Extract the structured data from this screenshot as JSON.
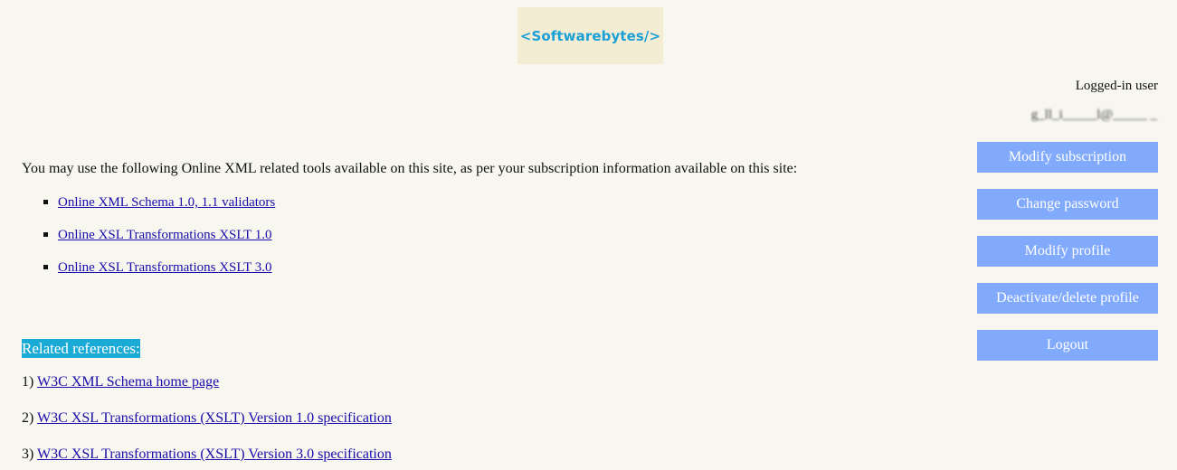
{
  "logo": {
    "text": "<Softwarebytes/>"
  },
  "user": {
    "label": "Logged-in user",
    "email": "g_ll_i_____l@_____ _"
  },
  "side_buttons": [
    "Modify subscription",
    "Change password",
    "Modify profile",
    "Deactivate/delete profile",
    "Logout"
  ],
  "intro": "You may use the following Online XML related tools available on this site, as per your subscription information available on this site:",
  "tools": [
    "Online XML Schema 1.0, 1.1 validators",
    "Online XSL Transformations XSLT 1.0",
    "Online XSL Transformations XSLT 3.0"
  ],
  "references": {
    "heading": "Related references:",
    "items": [
      {
        "num": "1)",
        "text": "W3C XML Schema home page"
      },
      {
        "num": "2)",
        "text": "W3C XSL Transformations (XSLT) Version 1.0 specification"
      },
      {
        "num": "3)",
        "text": "W3C XSL Transformations (XSLT) Version 3.0 specification"
      }
    ]
  },
  "colors": {
    "background": "#f7f6ef",
    "logo_box": "#f5edd3",
    "logo_text": "#1a9fd6",
    "button_bg": "#82aafc",
    "heading_bg": "#1aaad6",
    "link": "#1a0dab"
  }
}
